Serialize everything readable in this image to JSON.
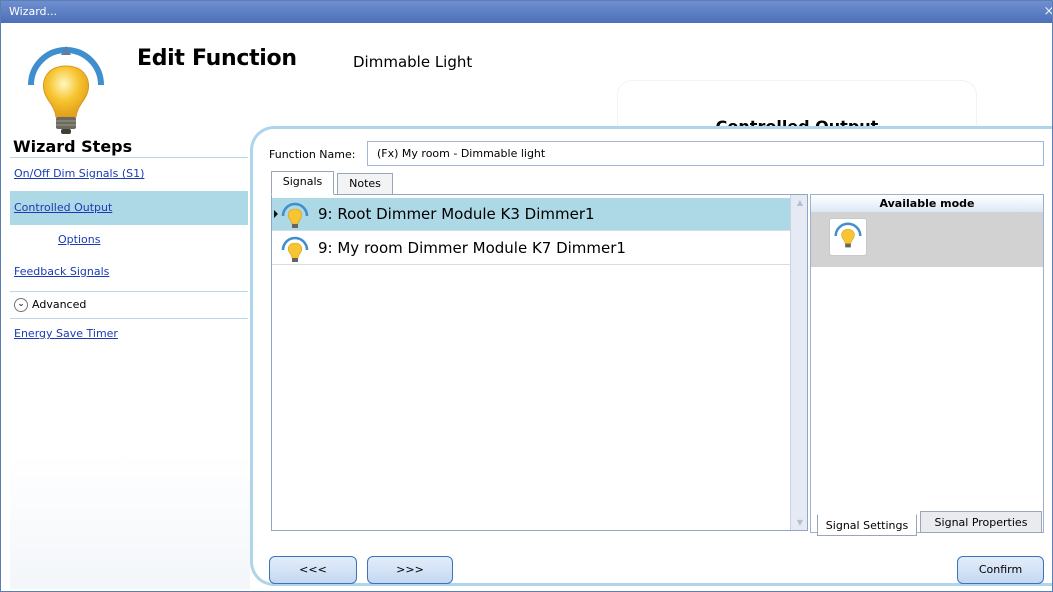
{
  "window": {
    "title": "Wizard...",
    "close": "×"
  },
  "header": {
    "title": "Edit Function",
    "subtitle": "Dimmable Light",
    "section": "Controlled Output"
  },
  "sidebar": {
    "title": "Wizard Steps",
    "steps": [
      {
        "label": "On/Off Dim Signals (S1)"
      },
      {
        "label": "Controlled Output"
      },
      {
        "label": "Options"
      },
      {
        "label": "Feedback Signals"
      }
    ],
    "advanced": {
      "label": "Advanced",
      "icon": "chevron-down-icon"
    },
    "advanced_steps": [
      {
        "label": "Energy Save Timer"
      }
    ]
  },
  "form": {
    "function_name_label": "Function Name:",
    "function_name_value": "(Fx) My room - Dimmable light"
  },
  "tabs": [
    {
      "label": "Signals"
    },
    {
      "label": "Notes"
    }
  ],
  "signals": [
    {
      "text": "9: Root Dimmer Module K3 Dimmer1",
      "icon": "dimmer-bulb-icon",
      "selected": true
    },
    {
      "text": "9: My room Dimmer Module K7 Dimmer1",
      "icon": "dimmer-bulb-icon",
      "selected": false
    }
  ],
  "mode_panel": {
    "header": "Available mode",
    "icon": "dimmer-bulb-icon"
  },
  "bottom_tabs": [
    {
      "label": "Signal Settings"
    },
    {
      "label": "Signal Properties"
    }
  ],
  "nav": {
    "back": "<<<",
    "forward": ">>>",
    "confirm": "Confirm"
  },
  "colors": {
    "titlebar": "#5777c4",
    "accent": "#add8e6",
    "link": "#1b3bb5",
    "bulb": "#f7c531"
  }
}
